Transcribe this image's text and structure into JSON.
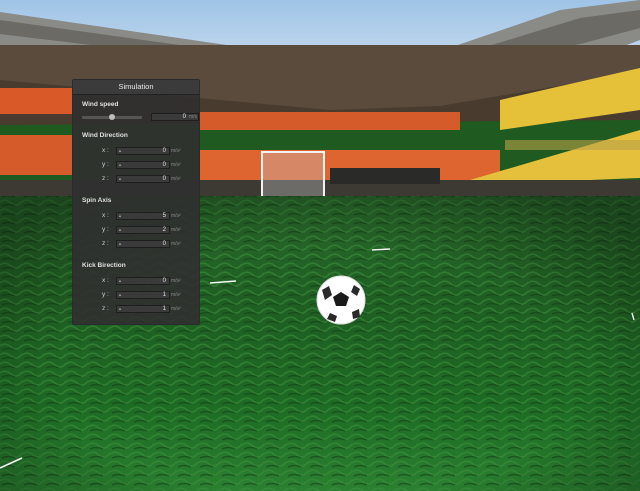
{
  "panel": {
    "title": "Simulation",
    "wind_speed": {
      "label": "Wind speed",
      "value": "0",
      "unit": "m/s",
      "slider_fraction": 0.5
    },
    "wind_direction": {
      "label": "Wind Direction",
      "rows": [
        {
          "axis": "x :",
          "value": "0",
          "unit": "m/s²"
        },
        {
          "axis": "y :",
          "value": "0",
          "unit": "m/s²"
        },
        {
          "axis": "z :",
          "value": "0",
          "unit": "m/s²"
        }
      ]
    },
    "spin_axis": {
      "label": "Spin Axis",
      "rows": [
        {
          "axis": "x :",
          "value": "5",
          "unit": "m/s²"
        },
        {
          "axis": "y :",
          "value": "2",
          "unit": "m/s²"
        },
        {
          "axis": "z :",
          "value": "0",
          "unit": "m/s²"
        }
      ]
    },
    "kick_direction": {
      "label": "Kick Birection",
      "rows": [
        {
          "axis": "x :",
          "value": "0",
          "unit": "m/s²"
        },
        {
          "axis": "y :",
          "value": "1",
          "unit": "m/s²"
        },
        {
          "axis": "z :",
          "value": "1",
          "unit": "m/s²"
        }
      ]
    }
  },
  "colors": {
    "sky": "#b9d3ea",
    "grass": "#1e6b22",
    "seats_orange": "#e0622a",
    "seats_yellow": "#e8c53a"
  }
}
